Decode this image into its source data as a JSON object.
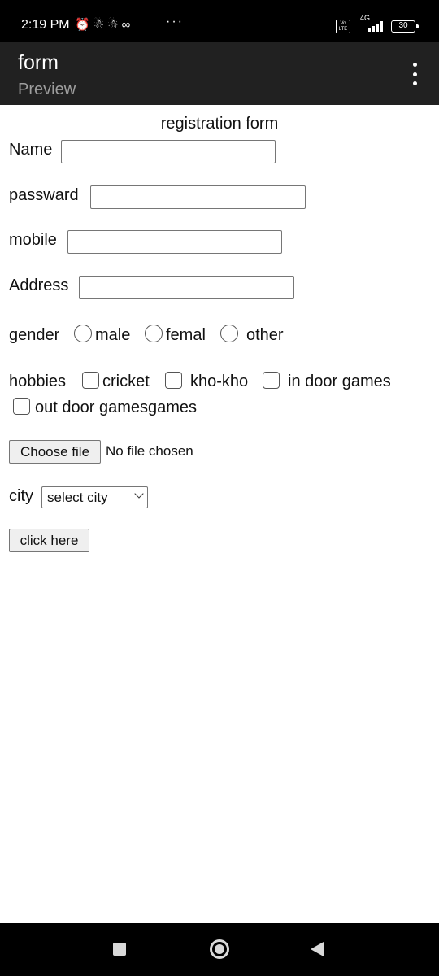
{
  "status_bar": {
    "time": "2:19 PM",
    "notification_icons": [
      "muted-alarm-icon",
      "snapchat-icon",
      "snapchat-icon",
      "infinity-icon"
    ],
    "more_notifications": "···",
    "volte": "Vo LTE",
    "network": "4G",
    "battery": "30"
  },
  "app_bar": {
    "title": "form",
    "subtitle": "Preview",
    "menu_icon": "more-vertical-icon"
  },
  "form": {
    "heading": "registration form",
    "name_label": "Name",
    "name_value": "",
    "password_label": "passward",
    "password_value": "",
    "mobile_label": "mobile",
    "mobile_value": "",
    "address_label": "Address",
    "address_value": "",
    "gender_label": "gender",
    "gender_options": [
      "male",
      "femal",
      "other"
    ],
    "hobbies_label": "hobbies",
    "hobby_options": [
      "cricket",
      "kho-kho",
      "in door games",
      "out door gamesgames"
    ],
    "file_button": "Choose file",
    "file_status": "No file chosen",
    "city_label": "city",
    "city_selected": "select city",
    "submit_label": "click here"
  },
  "nav_bar": {
    "icons": [
      "recent-apps-icon",
      "home-icon",
      "back-icon"
    ]
  },
  "colors": {
    "status_bar_bg": "#000000",
    "app_bar_bg": "#212121",
    "page_bg": "#ffffff",
    "button_bg": "#efefef"
  }
}
